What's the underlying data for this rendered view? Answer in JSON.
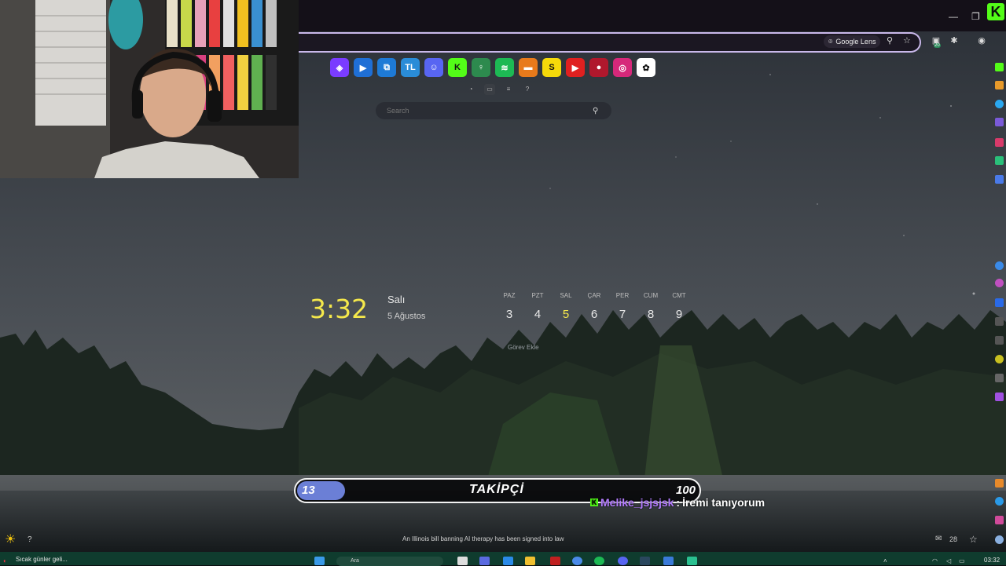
{
  "browser": {
    "lens_label": "Google Lens",
    "extension_badge": "20",
    "window_controls": {
      "minimize": "—",
      "maximize": "❐"
    }
  },
  "shortcuts": [
    {
      "name": "shortcut-1",
      "text": "◈",
      "color": "#7a3cff"
    },
    {
      "name": "shortcut-2",
      "text": "▶",
      "color": "#1f6fd6"
    },
    {
      "name": "shortcut-3",
      "text": "⧉",
      "color": "#1e7ad6"
    },
    {
      "name": "shortcut-tl",
      "text": "TL",
      "color": "#2a8cd8"
    },
    {
      "name": "shortcut-discord",
      "text": "☺",
      "color": "#5865f2"
    },
    {
      "name": "shortcut-kick",
      "text": "K",
      "color": "#53fc18"
    },
    {
      "name": "shortcut-dolap",
      "text": "♀",
      "color": "#2d8a4e"
    },
    {
      "name": "shortcut-spotify",
      "text": "≋",
      "color": "#1db954"
    },
    {
      "name": "shortcut-5",
      "text": "▬",
      "color": "#e87a1b"
    },
    {
      "name": "shortcut-s",
      "text": "S",
      "color": "#f5d90a"
    },
    {
      "name": "shortcut-youtube",
      "text": "▶",
      "color": "#e02020"
    },
    {
      "name": "shortcut-6",
      "text": "●",
      "color": "#b0182d"
    },
    {
      "name": "shortcut-instagram",
      "text": "◎",
      "color": "#d6287a"
    },
    {
      "name": "shortcut-chatgpt",
      "text": "✿",
      "color": "#ffffff"
    }
  ],
  "search": {
    "placeholder": "Search"
  },
  "clock": {
    "time": "3:32",
    "day": "Salı",
    "date": "5 Ağustos"
  },
  "week": [
    {
      "name": "PAZ",
      "num": "3"
    },
    {
      "name": "PZT",
      "num": "4"
    },
    {
      "name": "SAL",
      "num": "5",
      "today": true
    },
    {
      "name": "ÇAR",
      "num": "6"
    },
    {
      "name": "PER",
      "num": "7"
    },
    {
      "name": "CUM",
      "num": "8"
    },
    {
      "name": "CMT",
      "num": "9"
    }
  ],
  "task_button": "Görev Ekle",
  "follower_goal": {
    "current": "13",
    "label": "TAKİPÇİ",
    "goal": "100",
    "progress": 0.13
  },
  "chat": {
    "username": "Melike_jsjsjsk",
    "separator": ":",
    "message": "İremi tanıyorum"
  },
  "news_headline": "An Illinois bill banning AI therapy has been signed into law",
  "mail_count": "28",
  "taskbar": {
    "weather_text": "Sıcak günler geli...",
    "search_placeholder": "Ara",
    "time": "03:32"
  },
  "colors": {
    "accent_yellow": "#f5e84b",
    "kick_green": "#53fc18",
    "progress_fill": "#6b7fd6",
    "chat_username": "#b47cff"
  }
}
